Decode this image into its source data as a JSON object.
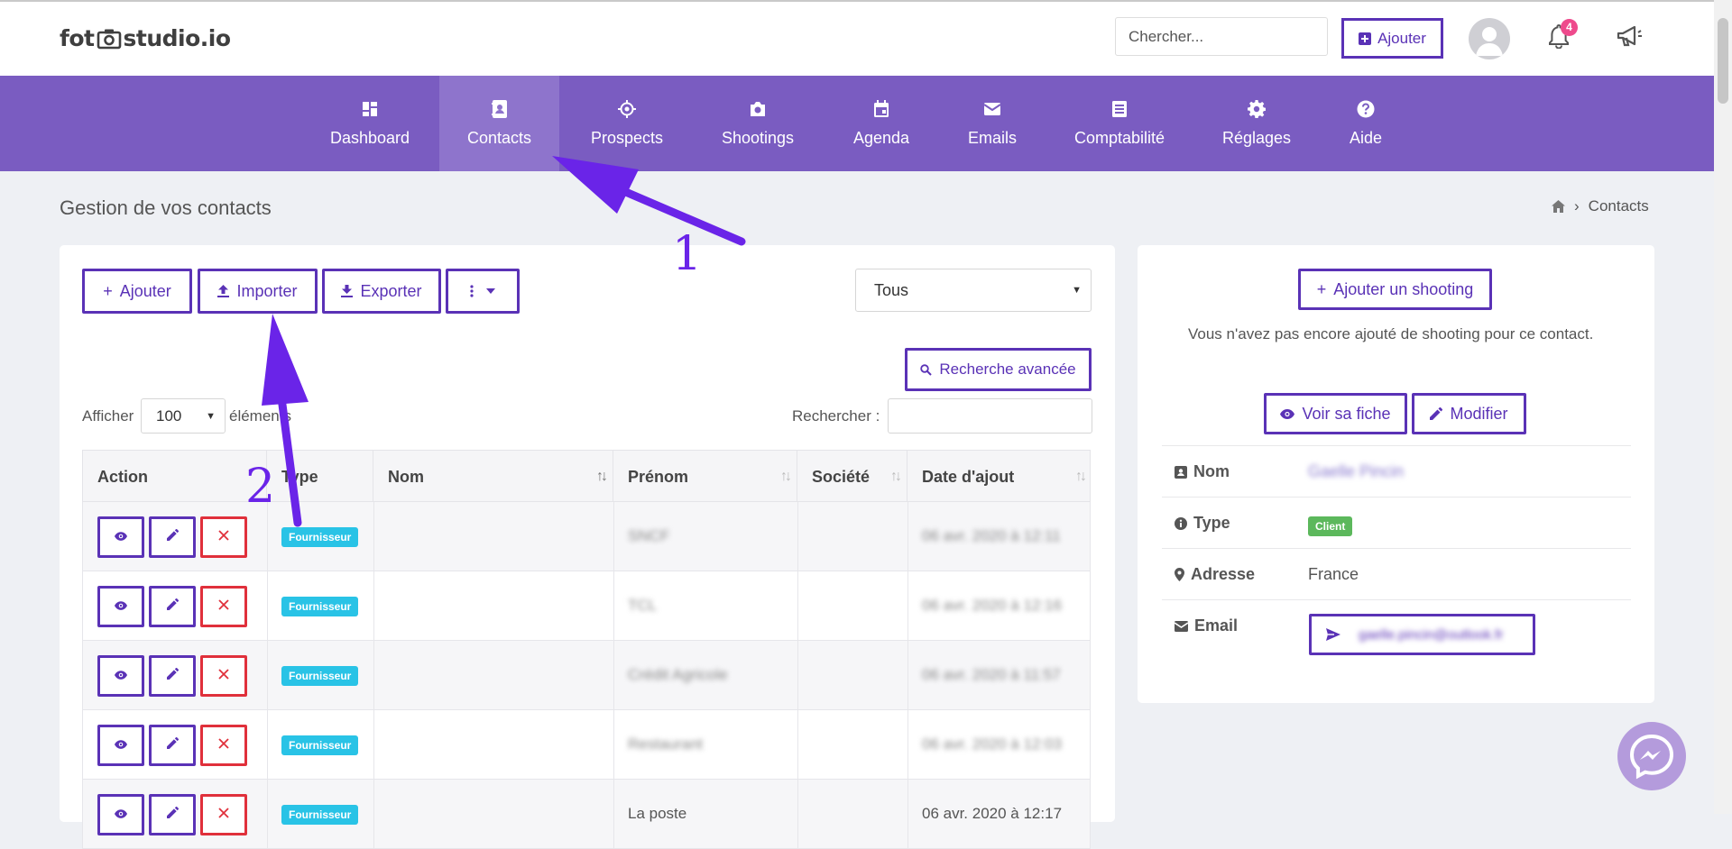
{
  "header": {
    "logo_left": "fot",
    "logo_right": "studio.io",
    "search_placeholder": "Chercher...",
    "add_label": "Ajouter",
    "notification_count": "4"
  },
  "nav": {
    "items": [
      {
        "label": "Dashboard",
        "icon": "dashboard-icon"
      },
      {
        "label": "Contacts",
        "icon": "contact-card-icon",
        "active": true
      },
      {
        "label": "Prospects",
        "icon": "crosshair-icon"
      },
      {
        "label": "Shootings",
        "icon": "camera-icon"
      },
      {
        "label": "Agenda",
        "icon": "calendar-icon"
      },
      {
        "label": "Emails",
        "icon": "envelope-icon"
      },
      {
        "label": "Comptabilité",
        "icon": "ledger-icon"
      },
      {
        "label": "Réglages",
        "icon": "gear-icon"
      },
      {
        "label": "Aide",
        "icon": "help-icon"
      }
    ]
  },
  "page": {
    "title": "Gestion de vos contacts",
    "breadcrumb": "Contacts"
  },
  "toolbar": {
    "add": "Ajouter",
    "import": "Importer",
    "export": "Exporter",
    "filter_value": "Tous",
    "advanced_search": "Recherche avancée",
    "show_label": "Afficher",
    "page_size": "100",
    "elements_label": "éléments",
    "search_label": "Rechercher :"
  },
  "table": {
    "columns": [
      "Action",
      "Type",
      "Nom",
      "Prénom",
      "Société",
      "Date d'ajout"
    ],
    "rows": [
      {
        "type": "Fournisseur",
        "prenom": "SNCF",
        "date": "06 avr. 2020 à 12:11"
      },
      {
        "type": "Fournisseur",
        "prenom": "TCL",
        "date": "06 avr. 2020 à 12:16"
      },
      {
        "type": "Fournisseur",
        "prenom": "Crédit Agricole",
        "date": "06 avr. 2020 à 11:57"
      },
      {
        "type": "Fournisseur",
        "prenom": "Restaurant",
        "date": "06 avr. 2020 à 12:03"
      },
      {
        "type": "Fournisseur",
        "prenom": "La poste",
        "date": "06 avr. 2020 à 12:17"
      }
    ]
  },
  "detail": {
    "add_shooting": "Ajouter un shooting",
    "no_shooting": "Vous n'avez pas encore ajouté de shooting pour ce contact.",
    "view_sheet": "Voir sa fiche",
    "edit": "Modifier",
    "fields": {
      "nom_label": "Nom",
      "nom_value": "Gaelle Pincin",
      "type_label": "Type",
      "type_value": "Client",
      "adresse_label": "Adresse",
      "adresse_value": "France",
      "email_label": "Email",
      "email_value": "gaelle.pincin@outlook.fr"
    }
  },
  "annotations": {
    "first": "1",
    "second": "2",
    "color": "#6a24e8"
  }
}
